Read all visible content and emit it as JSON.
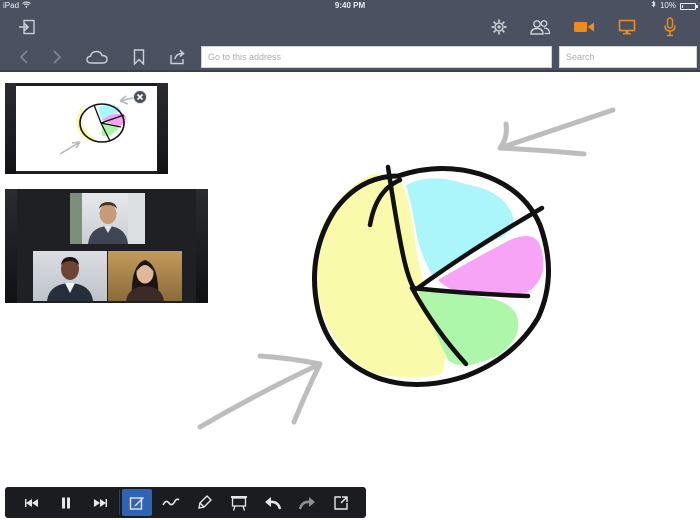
{
  "status_bar": {
    "device": "iPad",
    "time": "9:40 PM",
    "battery": "10%",
    "battery_fraction": 0.1
  },
  "toolbar": {
    "icons_top": [
      "exit-icon",
      "gear-icon",
      "participants-icon",
      "video-camera-icon",
      "screen-share-icon",
      "microphone-icon"
    ],
    "icons_nav": [
      "back-icon",
      "forward-icon",
      "cloud-icon",
      "bookmark-icon",
      "share-icon"
    ],
    "accent_color": "#f08a1c"
  },
  "address": {
    "placeholder": "Go to this address"
  },
  "search": {
    "placeholder": "Search"
  },
  "bottom_toolbar": {
    "buttons": [
      "rewind-icon",
      "pause-icon",
      "fast-forward-icon",
      "annotate-icon",
      "pen-icon",
      "highlighter-icon",
      "whiteboard-icon",
      "undo-icon",
      "redo-icon",
      "export-icon"
    ],
    "active": "annotate-icon",
    "active_color": "#2f63b6"
  },
  "drawing": {
    "pie_colors": [
      "#fafaa6",
      "#a6f6fb",
      "#f79ff5",
      "#a9f7a6"
    ],
    "arrow_color": "#bdbdbd"
  }
}
